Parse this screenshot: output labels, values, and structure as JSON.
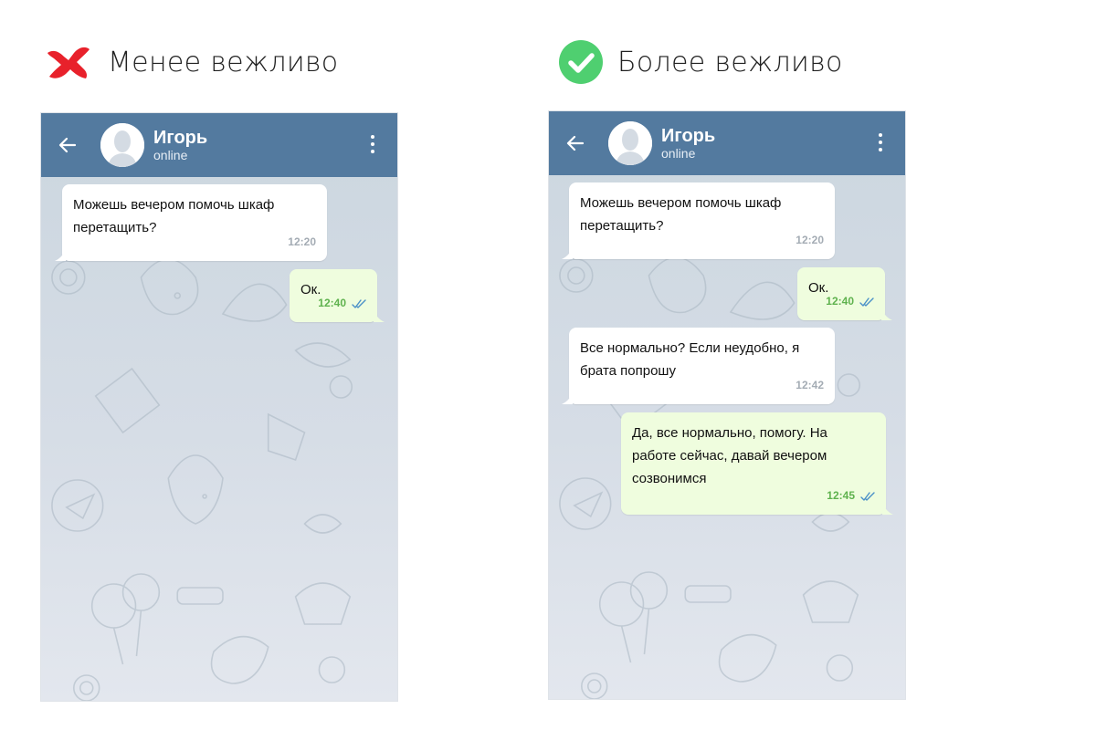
{
  "left_panel": {
    "heading": "Менее вежливо",
    "chat": {
      "peer_name": "Игорь",
      "peer_status": "online",
      "messages": [
        {
          "direction": "in",
          "text": "Можешь вечером помочь шкаф перетащить?",
          "time": "12:20"
        },
        {
          "direction": "out",
          "text": "Ок.",
          "time": "12:40"
        }
      ]
    }
  },
  "right_panel": {
    "heading": "Более вежливо",
    "chat": {
      "peer_name": "Игорь",
      "peer_status": "online",
      "messages": [
        {
          "direction": "in",
          "text": "Можешь вечером помочь шкаф перетащить?",
          "time": "12:20"
        },
        {
          "direction": "out",
          "text": "Ок.",
          "time": "12:40"
        },
        {
          "direction": "in",
          "text": "Все нормально? Если неудобно, я брата попрошу",
          "time": "12:42"
        },
        {
          "direction": "out",
          "text": "Да, все нормально, помогу. На работе сейчас, давай вечером созвонимся",
          "time": "12:45"
        }
      ]
    }
  },
  "icons": {
    "less_polite": "red-x-icon",
    "more_polite": "green-check-icon",
    "back": "arrow-left-icon",
    "menu": "vertical-dots-icon",
    "read_receipt": "double-check-icon"
  },
  "colors": {
    "header": "#537a9f",
    "incoming_bubble": "#ffffff",
    "outgoing_bubble": "#effdde",
    "outgoing_time": "#5fb24e",
    "incoming_time": "#a4acb4",
    "red_x": "#e8212b",
    "green_check": "#4fcf70"
  }
}
